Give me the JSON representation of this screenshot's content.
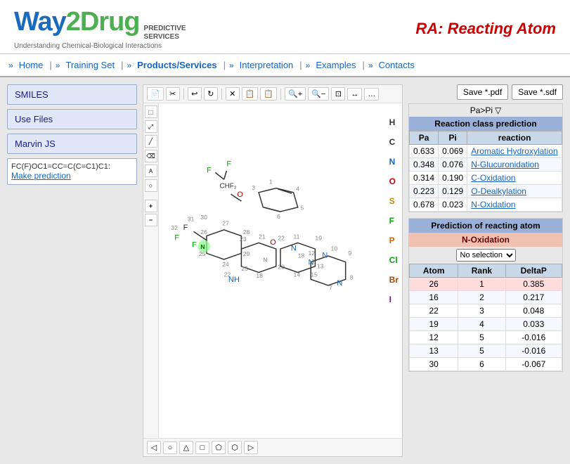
{
  "header": {
    "logo_way": "Way",
    "logo_2drug": "2Drug",
    "predictive_services_line1": "PREDICTIVE",
    "predictive_services_line2": "SERVICES",
    "tagline": "Understanding Chemical-Biological Interactions",
    "ra_title": "RA: Reacting Atom"
  },
  "nav": {
    "items": [
      {
        "label": "Home",
        "id": "home"
      },
      {
        "label": "Training Set",
        "id": "training-set"
      },
      {
        "label": "Products/Services",
        "id": "products-services"
      },
      {
        "label": "Interpretation",
        "id": "interpretation"
      },
      {
        "label": "Examples",
        "id": "examples"
      },
      {
        "label": "Contacts",
        "id": "contacts"
      }
    ]
  },
  "left_panel": {
    "smiles_btn": "SMILES",
    "use_files_btn": "Use Files",
    "marvin_js_btn": "Marvin JS",
    "smiles_value": "FC(F)OC1=CC=C(C=C1)C1:",
    "make_prediction": "Make prediction"
  },
  "toolbar": {
    "buttons": [
      "📄",
      "✂",
      "↩",
      "↺",
      "↻",
      "✕",
      "📋",
      "📋",
      "🔍+",
      "🔍-",
      "⊡",
      "↔",
      "…"
    ],
    "save_pdf": "Save *.pdf",
    "save_sdf": "Save *.sdf"
  },
  "side_labels": [
    "H",
    "C",
    "N",
    "O",
    "S",
    "F",
    "P",
    "Cl",
    "Br",
    "I"
  ],
  "reaction_class": {
    "pp_pi_label": "Pa>Pi",
    "section_title": "Reaction class prediction",
    "col_pa": "Pa",
    "col_pi": "Pi",
    "col_reaction": "reaction",
    "rows": [
      {
        "pa": "0.633",
        "pi": "0.069",
        "reaction": "Aromatic Hydroxylation"
      },
      {
        "pa": "0.348",
        "pi": "0.076",
        "reaction": "N-Glucuronidation"
      },
      {
        "pa": "0.314",
        "pi": "0.190",
        "reaction": "C-Oxidation"
      },
      {
        "pa": "0.223",
        "pi": "0.129",
        "reaction": "O-Dealkylation"
      },
      {
        "pa": "0.678",
        "pi": "0.023",
        "reaction": "N-Oxidation"
      }
    ]
  },
  "reacting_atom": {
    "section_title": "Prediction of reacting atom",
    "reaction_name": "N-Oxidation",
    "selection_label": "No selection",
    "col_atom": "Atom",
    "col_rank": "Rank",
    "col_deltap": "DeltaP",
    "rows": [
      {
        "atom": "26",
        "rank": "1",
        "deltap": "0.385",
        "highlight": true
      },
      {
        "atom": "16",
        "rank": "2",
        "deltap": "0.217",
        "highlight": false
      },
      {
        "atom": "22",
        "rank": "3",
        "deltap": "0.048",
        "highlight": false
      },
      {
        "atom": "19",
        "rank": "4",
        "deltap": "0.033",
        "highlight": false
      },
      {
        "atom": "12",
        "rank": "5",
        "deltap": "-0.016",
        "highlight": false
      },
      {
        "atom": "13",
        "rank": "5",
        "deltap": "-0.016",
        "highlight": false
      },
      {
        "atom": "30",
        "rank": "6",
        "deltap": "-0.067",
        "highlight": false
      }
    ]
  },
  "mol_bottom_tools": [
    "◁",
    "○",
    "△",
    "□",
    "⬠",
    "⬡",
    "▷"
  ],
  "zoom_controls": [
    "+",
    "-"
  ]
}
